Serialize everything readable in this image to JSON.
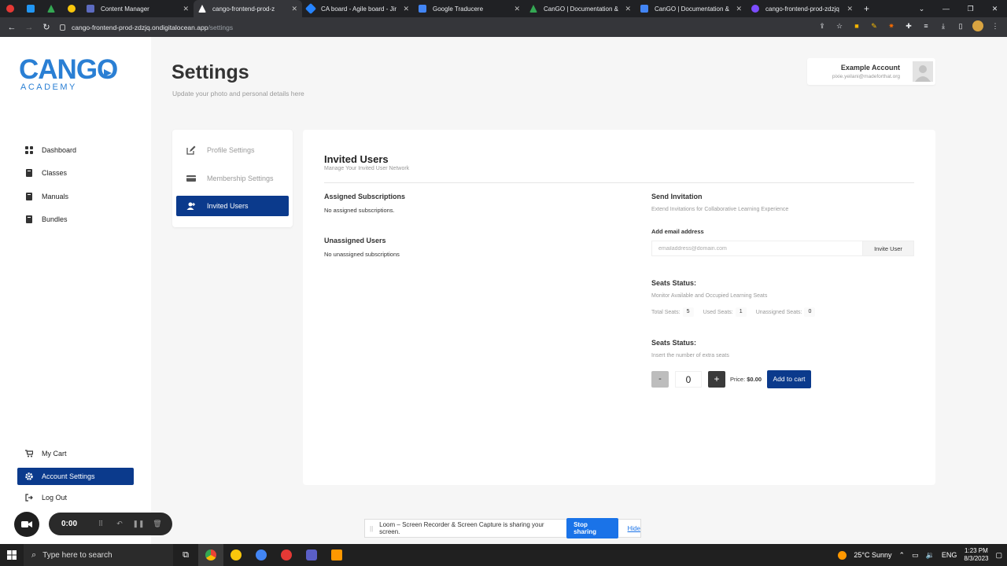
{
  "browser": {
    "tabs": [
      {
        "label": "",
        "color": "#e53935"
      },
      {
        "label": "",
        "color": "#2196f3"
      },
      {
        "label": "",
        "color": "#34a853"
      },
      {
        "label": "",
        "color": "#f9c70c"
      },
      {
        "label": "Content Manager",
        "color": "#5c6bc0"
      },
      {
        "label": "cango-frontend-prod-z",
        "color": "#ffffff"
      },
      {
        "label": "CA board - Agile board - Jir",
        "color": "#2684ff"
      },
      {
        "label": "Google Traducere",
        "color": "#4285f4"
      },
      {
        "label": "CanGO | Documentation &",
        "color": "#34a853"
      },
      {
        "label": "CanGO | Documentation &",
        "color": "#4285f4"
      },
      {
        "label": "cango-frontend-prod-zdzjq",
        "color": "#7c4dff"
      }
    ],
    "url_host": "cango-frontend-prod-zdzjq.ondigitalocean.app",
    "url_path": "/settings"
  },
  "sidebar": {
    "logo_top": "CANGO",
    "logo_bottom": "ACADEMY",
    "items": [
      {
        "label": "Dashboard"
      },
      {
        "label": "Classes"
      },
      {
        "label": "Manuals"
      },
      {
        "label": "Bundles"
      }
    ],
    "bottom_items": [
      {
        "label": "My Cart"
      },
      {
        "label": "Account Settings"
      },
      {
        "label": "Log Out"
      }
    ]
  },
  "header": {
    "title": "Settings",
    "subtitle": "Update your photo and personal details here",
    "account_name": "Example Account",
    "account_email": "pixie.yeilani@madeforthat.org"
  },
  "settings_menu": [
    {
      "label": "Profile Settings"
    },
    {
      "label": "Membership Settings"
    },
    {
      "label": "Invited Users"
    }
  ],
  "panel": {
    "title": "Invited Users",
    "subtitle": "Manage Your Invited User Network",
    "assigned_title": "Assigned Subscriptions",
    "assigned_text": "No assigned subscriptions.",
    "unassigned_title": "Unassigned Users",
    "unassigned_text": "No unassigned subscriptions",
    "send_title": "Send Invitation",
    "send_sub": "Extend Invitations for Collaborative Learning Experience",
    "email_label": "Add email address",
    "email_placeholder": "emailaddress@domain.com",
    "invite_label": "Invite User",
    "seats_title": "Seats Status:",
    "seats_sub": "Monitor Available and Occupied Learning Seats",
    "total_label": "Total Seats:",
    "total_value": "5",
    "used_label": "Used Seats:",
    "used_value": "1",
    "unassigned_label": "Unassigned Seats:",
    "unassigned_value": "0",
    "extra_title": "Seats Status:",
    "extra_sub": "Insert the number of extra seats",
    "minus": "-",
    "qty": "0",
    "plus": "+",
    "price_label": "Price:",
    "price_value": "$0.00",
    "cart_label": "Add to cart"
  },
  "loom": {
    "time": "0:00",
    "banner": "Loom – Screen Recorder & Screen Capture is sharing your screen.",
    "stop": "Stop sharing",
    "hide": "Hide"
  },
  "taskbar": {
    "search": "Type here to search",
    "weather": "25°C  Sunny",
    "lang": "ENG",
    "time": "1:23 PM",
    "date": "8/3/2023"
  }
}
